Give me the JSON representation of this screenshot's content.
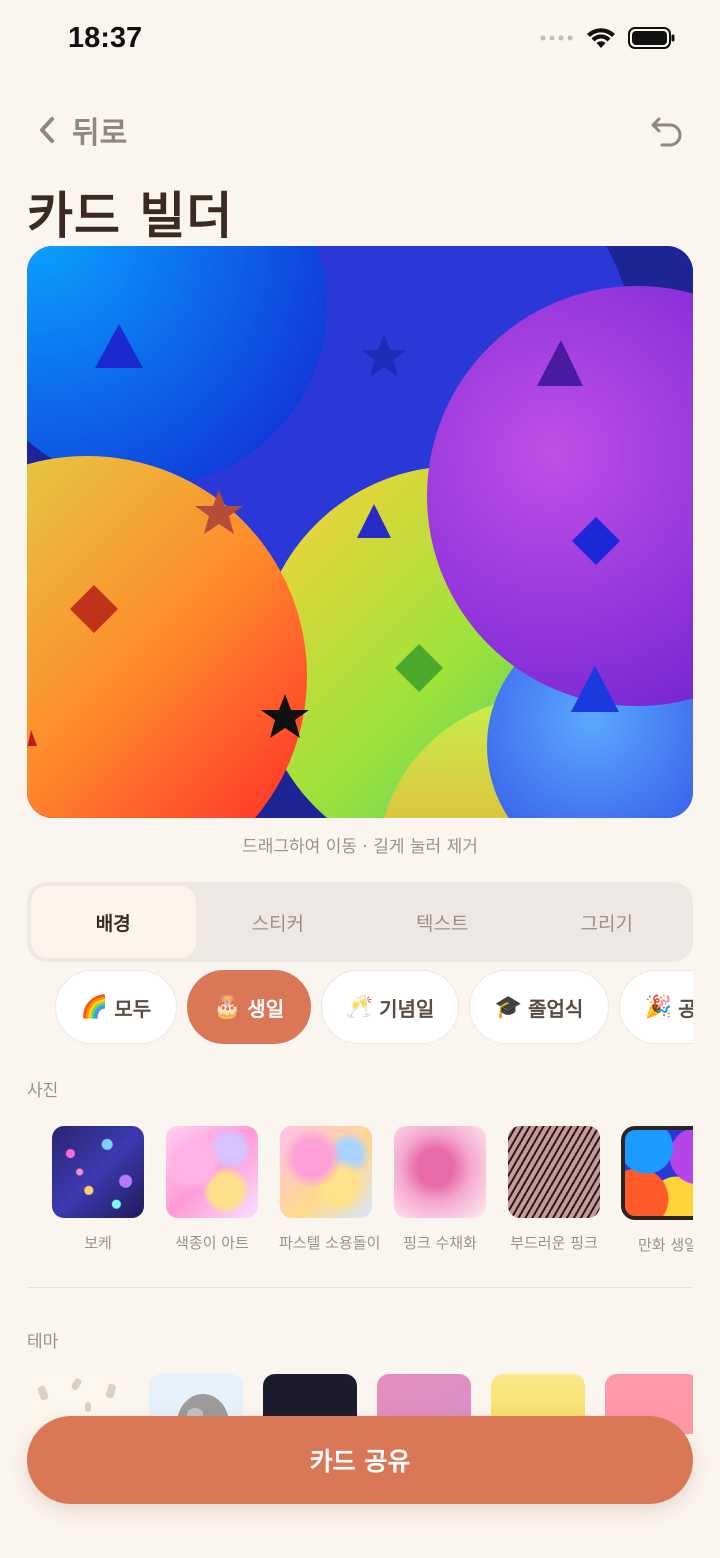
{
  "status_bar": {
    "time": "18:37"
  },
  "header": {
    "back_label": "뒤로",
    "title": "카드 빌더"
  },
  "canvas": {
    "hint": "드래그하여 이동 · 길게 눌러 제거"
  },
  "tabs": [
    {
      "label": "배경",
      "active": true
    },
    {
      "label": "스티커",
      "active": false
    },
    {
      "label": "텍스트",
      "active": false
    },
    {
      "label": "그리기",
      "active": false
    }
  ],
  "categories": [
    {
      "emoji": "🌈",
      "label": "모두",
      "active": false
    },
    {
      "emoji": "🎂",
      "label": "생일",
      "active": true
    },
    {
      "emoji": "🥂",
      "label": "기념일",
      "active": false
    },
    {
      "emoji": "🎓",
      "label": "졸업식",
      "active": false
    },
    {
      "emoji": "🎉",
      "label": "공휴일",
      "active": false
    }
  ],
  "photos": {
    "section_label": "사진",
    "items": [
      {
        "label": "보케"
      },
      {
        "label": "색종이 아트"
      },
      {
        "label": "파스텔 소용돌이"
      },
      {
        "label": "핑크 수채화"
      },
      {
        "label": "부드러운 핑크"
      },
      {
        "label": "만화 생일",
        "selected": true
      }
    ]
  },
  "themes": {
    "section_label": "테마",
    "swatch_colors": [
      "#fbf7ee",
      "#e6f1fb",
      "#1c1b2e",
      "#e58fbe",
      "#f8e07a",
      "#ff99a8"
    ]
  },
  "share_button": {
    "label": "카드 공유"
  },
  "colors": {
    "accent": "#d97757",
    "background": "#fbf5ef"
  }
}
